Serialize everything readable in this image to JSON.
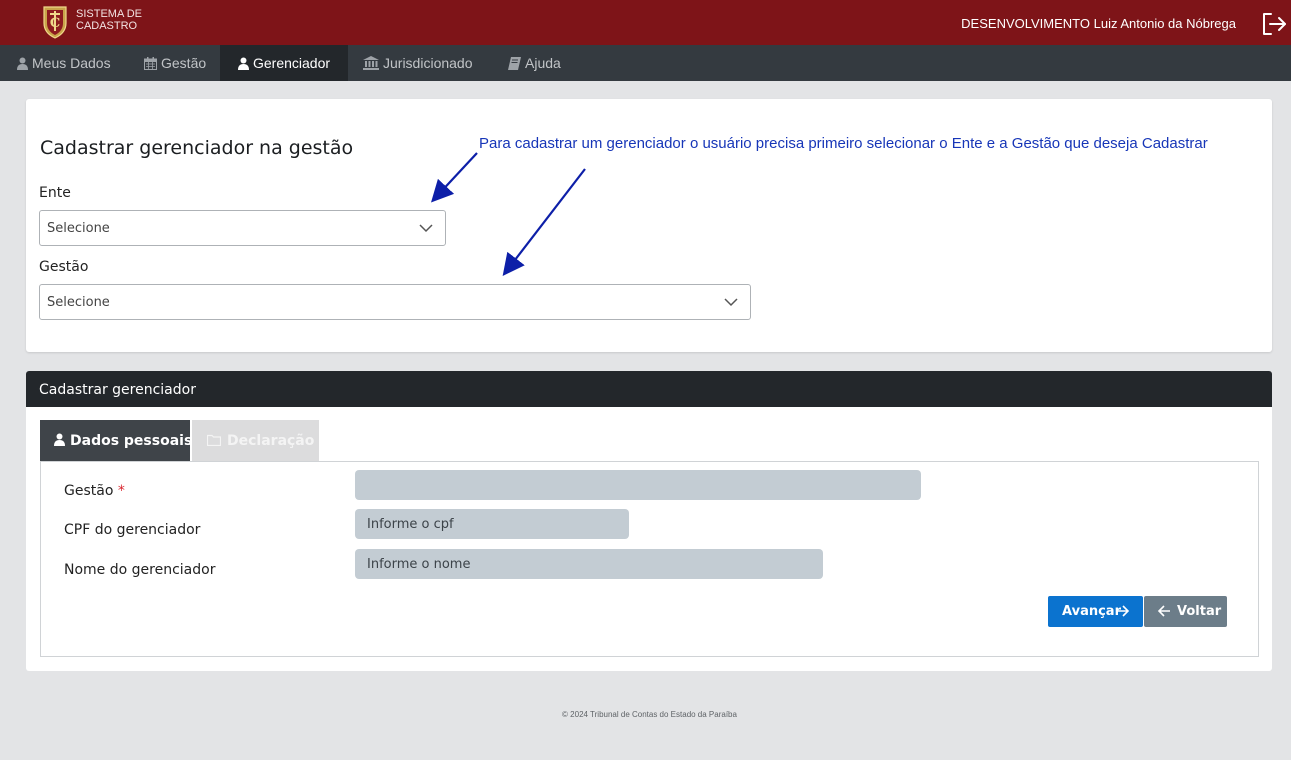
{
  "header": {
    "brand_line1": "SISTEMA DE",
    "brand_line2": "CADASTRO",
    "user": "DESENVOLVIMENTO Luiz Antonio da Nóbrega",
    "colors": {
      "topbar": "#7e1418",
      "navbar": "#343a40"
    }
  },
  "nav": {
    "items": [
      {
        "label": "Meus Dados",
        "icon": "user-icon"
      },
      {
        "label": "Gestão",
        "icon": "calendar-icon"
      },
      {
        "label": "Gerenciador",
        "icon": "user-icon",
        "active": true
      },
      {
        "label": "Jurisdicionado",
        "icon": "institution-icon"
      },
      {
        "label": "Ajuda",
        "icon": "book-icon"
      }
    ]
  },
  "selection_card": {
    "title": "Cadastrar gerenciador na gestão",
    "hint": "Para cadastrar um gerenciador o usuário precisa primeiro selecionar o Ente e a Gestão que deseja Cadastrar",
    "ente_label": "Ente",
    "ente_value": "Selecione",
    "gestao_label": "Gestão",
    "gestao_value": "Selecione"
  },
  "form_card": {
    "header": "Cadastrar gerenciador",
    "tabs": [
      {
        "label": "Dados pessoais",
        "icon": "user-icon",
        "active": true
      },
      {
        "label": "Declaração",
        "icon": "folder-icon",
        "active": false
      }
    ],
    "fields": {
      "gestao_label": "Gestão",
      "gestao_required": "*",
      "gestao_value": "",
      "cpf_label": "CPF do gerenciador",
      "cpf_placeholder": "Informe o cpf",
      "nome_label": "Nome do gerenciador",
      "nome_placeholder": "Informe o nome"
    },
    "buttons": {
      "next": "Avançar",
      "back": "Voltar"
    }
  },
  "footer": "© 2024 Tribunal de Contas do Estado da Paraíba"
}
